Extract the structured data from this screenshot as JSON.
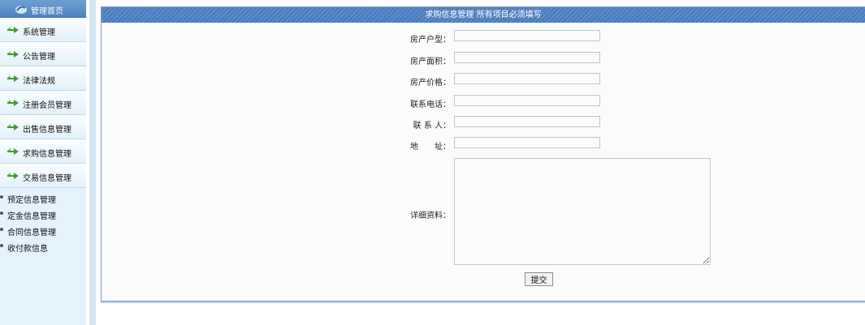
{
  "sidebar": {
    "header": "管理首页",
    "items": [
      {
        "label": "系统管理",
        "name": "sidebar-item-system"
      },
      {
        "label": "公告管理",
        "name": "sidebar-item-notice"
      },
      {
        "label": "法律法规",
        "name": "sidebar-item-laws"
      },
      {
        "label": "注册会员管理",
        "name": "sidebar-item-members"
      },
      {
        "label": "出售信息管理",
        "name": "sidebar-item-sale-info"
      },
      {
        "label": "求购信息管理",
        "name": "sidebar-item-purchase-info"
      },
      {
        "label": "交易信息管理",
        "name": "sidebar-item-trade-info"
      }
    ],
    "sub_items": [
      {
        "label": "预定信息管理",
        "name": "subitem-reservation"
      },
      {
        "label": "定金信息管理",
        "name": "subitem-deposit"
      },
      {
        "label": "合同信息管理",
        "name": "subitem-contract"
      },
      {
        "label": "收付款信息",
        "name": "subitem-payment"
      }
    ]
  },
  "main": {
    "title": "求购信息管理  所有项目必须填写",
    "form": {
      "house_type": {
        "label": "房产户型：",
        "value": ""
      },
      "house_area": {
        "label": "房产面积：",
        "value": ""
      },
      "house_price": {
        "label": "房产价格：",
        "value": ""
      },
      "phone": {
        "label": "联系电话：",
        "value": ""
      },
      "contact": {
        "label": "联 系 人：",
        "value": ""
      },
      "address": {
        "label": "地　　址：",
        "value": ""
      },
      "details": {
        "label": "详细资料：",
        "value": ""
      }
    },
    "submit_label": "提交"
  },
  "colors": {
    "title_bar": "#4f7fbf",
    "sidebar_bg": "#e4f3fb",
    "arrow_green": "#3f9b2f"
  }
}
